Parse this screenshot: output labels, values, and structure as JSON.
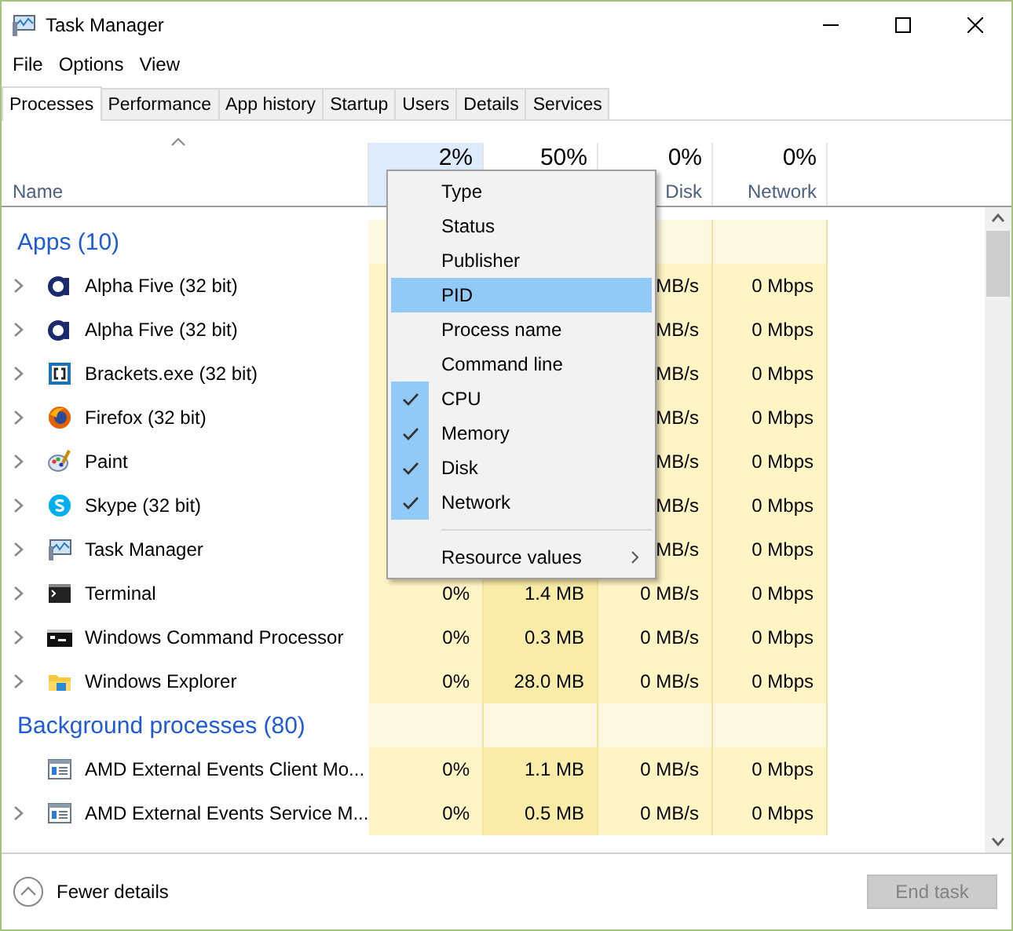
{
  "window": {
    "title": "Task Manager"
  },
  "menu_bar": [
    "File",
    "Options",
    "View"
  ],
  "tabs": [
    {
      "label": "Processes",
      "selected": true
    },
    {
      "label": "Performance",
      "selected": false
    },
    {
      "label": "App history",
      "selected": false
    },
    {
      "label": "Startup",
      "selected": false
    },
    {
      "label": "Users",
      "selected": false
    },
    {
      "label": "Details",
      "selected": false
    },
    {
      "label": "Services",
      "selected": false
    }
  ],
  "table": {
    "columns": [
      {
        "label": "Name",
        "sorted": true
      },
      {
        "percent": "2%"
      },
      {
        "percent": "50%"
      },
      {
        "percent": "0%",
        "label": "Disk"
      },
      {
        "percent": "0%",
        "label": "Network"
      }
    ],
    "groups": [
      {
        "title": "Apps (10)",
        "rows": [
          {
            "name": "Alpha Five (32 bit)",
            "kind": "alpha",
            "expandable": true,
            "disk": "MB/s",
            "network": "0 Mbps"
          },
          {
            "name": "Alpha Five (32 bit)",
            "kind": "alpha",
            "expandable": true,
            "disk": "MB/s",
            "network": "0 Mbps"
          },
          {
            "name": "Brackets.exe (32 bit)",
            "kind": "brackets",
            "expandable": true,
            "disk": "MB/s",
            "network": "0 Mbps"
          },
          {
            "name": "Firefox (32 bit)",
            "kind": "firefox",
            "expandable": true,
            "disk": "MB/s",
            "network": "0 Mbps"
          },
          {
            "name": "Paint",
            "kind": "paint",
            "expandable": true,
            "disk": "MB/s",
            "network": "0 Mbps"
          },
          {
            "name": "Skype (32 bit)",
            "kind": "skype",
            "expandable": true,
            "disk": "MB/s",
            "network": "0 Mbps"
          },
          {
            "name": "Task Manager",
            "kind": "monitor",
            "expandable": true,
            "disk": "MB/s",
            "network": "0 Mbps"
          },
          {
            "name": "Terminal",
            "kind": "terminal",
            "expandable": true,
            "cpu": "0%",
            "memory": "1.4 MB",
            "disk": "0 MB/s",
            "network": "0 Mbps"
          },
          {
            "name": "Windows Command Processor",
            "kind": "cmd",
            "expandable": true,
            "cpu": "0%",
            "memory": "0.3 MB",
            "disk": "0 MB/s",
            "network": "0 Mbps"
          },
          {
            "name": "Windows Explorer",
            "kind": "folder",
            "expandable": true,
            "cpu": "0%",
            "memory": "28.0 MB",
            "disk": "0 MB/s",
            "network": "0 Mbps"
          }
        ]
      },
      {
        "title": "Background processes (80)",
        "rows": [
          {
            "name": "AMD External Events Client Mo...",
            "kind": "service",
            "expandable": false,
            "cpu": "0%",
            "memory": "1.1 MB",
            "disk": "0 MB/s",
            "network": "0 Mbps"
          },
          {
            "name": "AMD External Events Service M...",
            "kind": "service",
            "expandable": true,
            "cpu": "0%",
            "memory": "0.5 MB",
            "disk": "0 MB/s",
            "network": "0 Mbps"
          }
        ]
      }
    ]
  },
  "context_menu": {
    "items": [
      {
        "label": "Type",
        "checked": false,
        "selected": false
      },
      {
        "label": "Status",
        "checked": false,
        "selected": false
      },
      {
        "label": "Publisher",
        "checked": false,
        "selected": false
      },
      {
        "label": "PID",
        "checked": false,
        "selected": true
      },
      {
        "label": "Process name",
        "checked": false,
        "selected": false
      },
      {
        "label": "Command line",
        "checked": false,
        "selected": false
      },
      {
        "label": "CPU",
        "checked": true,
        "selected": false
      },
      {
        "label": "Memory",
        "checked": true,
        "selected": false
      },
      {
        "label": "Disk",
        "checked": true,
        "selected": false
      },
      {
        "label": "Network",
        "checked": true,
        "selected": false
      }
    ],
    "submenu": {
      "label": "Resource values"
    }
  },
  "footer": {
    "toggle": "Fewer details",
    "button": {
      "label": "End task",
      "disabled": true
    }
  }
}
